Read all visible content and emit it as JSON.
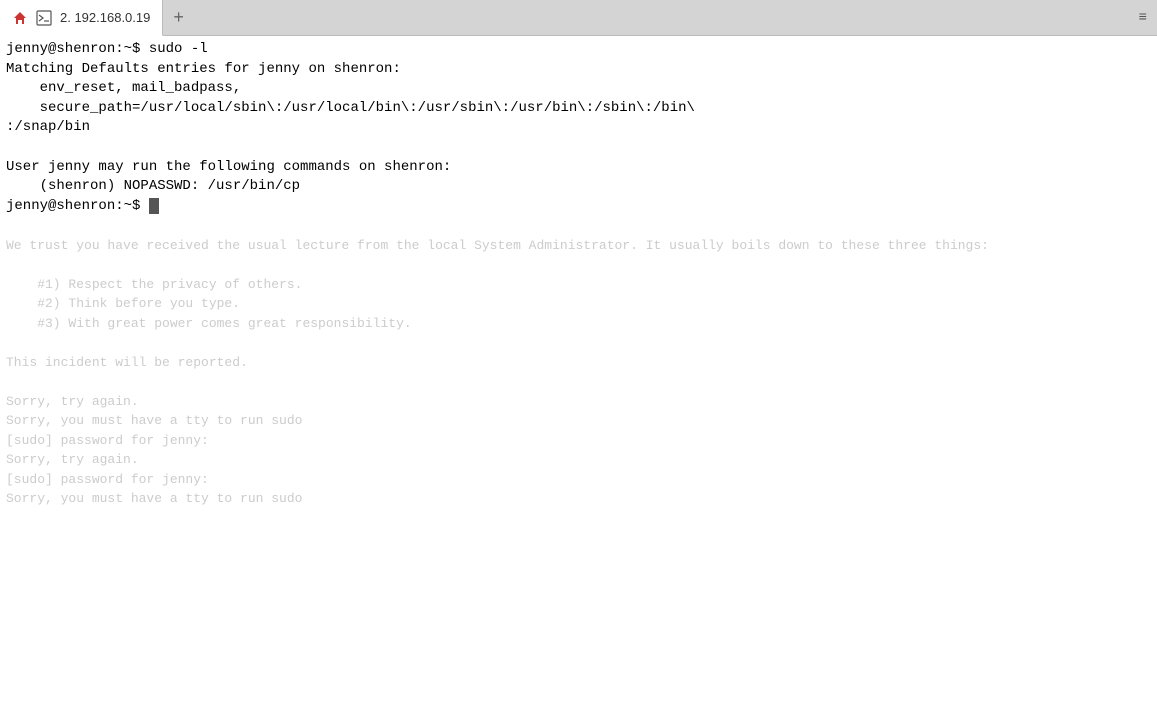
{
  "tabBar": {
    "tabs": [
      {
        "id": "tab-1",
        "label": "2. 192.168.0.19",
        "active": true,
        "icon": "terminal-icon"
      }
    ],
    "newTabLabel": "+",
    "rightIcon": "≡"
  },
  "terminal": {
    "lines": [
      "jenny@shenron:~$ sudo -l",
      "Matching Defaults entries for jenny on shenron:",
      "    env_reset, mail_badpass,",
      "    secure_path=/usr/local/sbin\\:/usr/local/bin\\:/usr/sbin\\:/usr/bin\\:/sbin\\:/bin\\",
      ":/snap/bin",
      "",
      "User jenny may run the following commands on shenron:",
      "    (shenron) NOPASSWD: /usr/bin/cp",
      "jenny@shenron:~$ "
    ],
    "fadedLines": [
      "We trust you have received the usual lecture from the local System",
      "Administrator. It usually boils down to these three things:",
      "",
      "    #1) Respect the privacy of others.",
      "    #2) Think before you type.",
      "    #3) With great power comes great responsibility.",
      "",
      "This incident will be reported.",
      "",
      "Sorry, try again.",
      "Sorry, you must have a tty to run sudo",
      "[sudo] password for jenny:",
      "Sorry, try again.",
      "[sudo] password for jenny:",
      "Sorry, you must have a tty to run sudo"
    ]
  }
}
